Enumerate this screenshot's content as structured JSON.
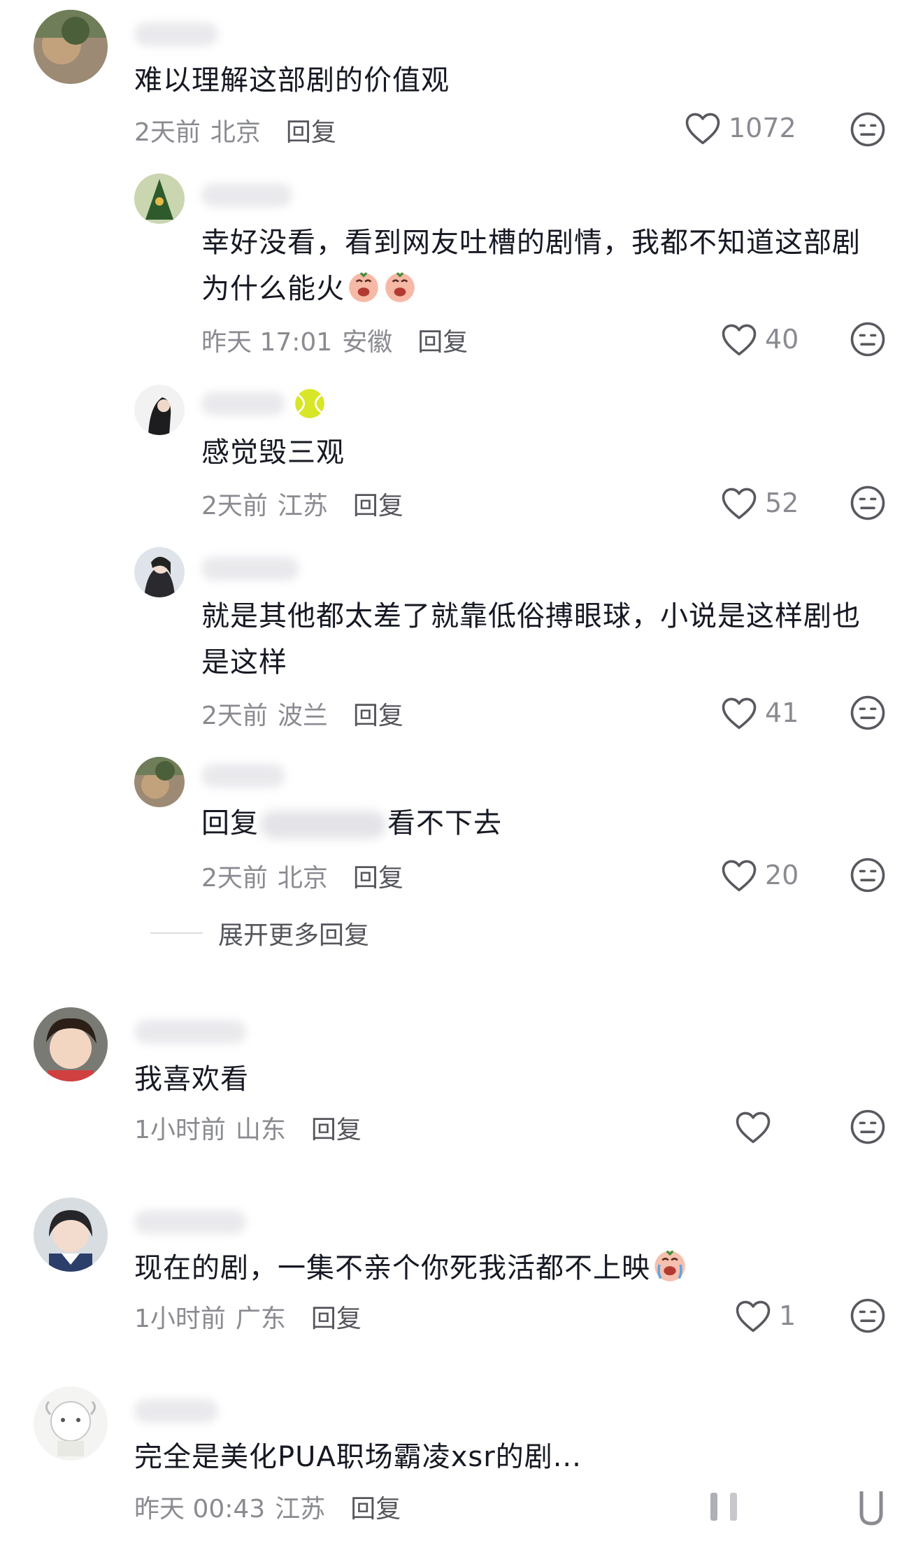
{
  "comments": [
    {
      "text": "难以理解这部剧的价值观",
      "time": "2天前",
      "location": "北京",
      "reply_label": "回复",
      "likes": "1072"
    },
    {
      "text": "幸好没看，看到网友吐槽的剧情，我都不知道这部剧为什么能火",
      "time": "昨天 17:01",
      "location": "安徽",
      "reply_label": "回复",
      "likes": "40"
    },
    {
      "text": "感觉毁三观",
      "time": "2天前",
      "location": "江苏",
      "reply_label": "回复",
      "likes": "52"
    },
    {
      "text": "就是其他都太差了就靠低俗搏眼球，小说是这样剧也是这样",
      "time": "2天前",
      "location": "波兰",
      "reply_label": "回复",
      "likes": "41"
    },
    {
      "text_prefix": "回复",
      "text_suffix": "看不下去",
      "time": "2天前",
      "location": "北京",
      "reply_label": "回复",
      "likes": "20"
    },
    {
      "text": "我喜欢看",
      "time": "1小时前",
      "location": "山东",
      "reply_label": "回复",
      "likes": ""
    },
    {
      "text": "现在的剧，一集不亲个你死我活都不上映",
      "time": "1小时前",
      "location": "广东",
      "reply_label": "回复",
      "likes": "1"
    },
    {
      "text": "完全是美化PUA职场霸凌xsr的剧...",
      "time": "昨天 00:43",
      "location": "江苏",
      "reply_label": "回复",
      "likes": ""
    }
  ],
  "expand_more": "展开更多回复",
  "icons": {
    "like": "heart-outline-icon",
    "dislike": "meh-face-icon",
    "emoji": "crying-emoji-icon"
  },
  "colors": {
    "text": "#161823",
    "meta": "#8a8b91",
    "reply": "#55565c"
  }
}
